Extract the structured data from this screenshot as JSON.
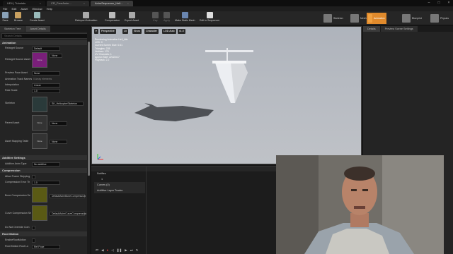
{
  "titlebar": {
    "tabs": [
      {
        "label": "UE4 | Tutorials",
        "active": false
      },
      {
        "label": "CR_FreeAnim...",
        "active": false
      },
      {
        "label": "AnimSequence_Heli...",
        "active": true
      }
    ]
  },
  "menu": [
    "File",
    "Edit",
    "Asset",
    "Window",
    "Help"
  ],
  "toolbar": {
    "buttons": [
      "Save",
      "Browse",
      "Create Asset",
      "Reimport Animation",
      "Compression",
      "Export Asset",
      "Key",
      "Apply",
      "Make Static Mesh",
      "Edit in Sequencer"
    ]
  },
  "modes": [
    "Skeleton",
    "Mesh",
    "Animation",
    "Blueprint",
    "Physics"
  ],
  "left_panel": {
    "tabs": [
      "Skeleton Tree",
      "Asset Details"
    ],
    "search_placeholder": "Search Details",
    "sections": {
      "animation": "Animation",
      "additive": "Additive Settings",
      "compression": "Compression",
      "root_motion": "Root Motion"
    },
    "rows": {
      "retarget_source": {
        "name": "Retarget Source",
        "value": "Default"
      },
      "retarget_source_asset": {
        "name": "Retarget Source Asset",
        "value": "None"
      },
      "preview_pose_asset": {
        "name": "Preview Pose Asset",
        "value": "None"
      },
      "animation_track_names": {
        "name": "Animation Track Names",
        "value": "0 Array elements"
      },
      "interpolation": {
        "name": "Interpolation",
        "value": "Linear"
      },
      "rate_scale": {
        "name": "Rate Scale",
        "value": "1.0"
      },
      "skeleton": {
        "name": "Skeleton",
        "value": "SK_HelicopterSkeleton"
      },
      "parent_asset": {
        "name": "Parent Asset",
        "value": "None"
      },
      "asset_mapping_table": {
        "name": "Asset Mapping Table",
        "value": "None"
      },
      "additive_anim_type": {
        "name": "Additive Anim Type",
        "value": "No additive"
      },
      "allow_frame_stripping": {
        "name": "Allow Frame Stripping",
        "value": ""
      },
      "compression_error_threshold": {
        "name": "Compression Error Th",
        "value": "1.0"
      },
      "bone_compression": {
        "name": "Bone Compression Se",
        "value": "DefaultAnimBoneCompression"
      },
      "curve_compression": {
        "name": "Curve Compression Se",
        "value": "DefaultAnimCurveCompression"
      },
      "do_not_override_compression": {
        "name": "Do Not Override Com",
        "value": ""
      },
      "enable_root_motion": {
        "name": "EnableRootMotion",
        "value": ""
      },
      "root_motion_root_lock": {
        "name": "Root Motion Root Lo",
        "value": "Ref Pose"
      }
    }
  },
  "viewport": {
    "buttons": [
      "Perspective",
      "Lit",
      "Show",
      "Character",
      "LOD Auto",
      "x1.0"
    ],
    "info": "Previewing Animation Heli_Idle\nLOD: 0\nCurrent Screen Size: 0.61\nTriangles: 228\nVertices: 176\nUV Channels: 1\nApprox Size: 22x22x17\nPlayback: 2.2"
  },
  "details": {
    "tabs": [
      "Details",
      "Preview Scene Settings"
    ]
  },
  "timeline": {
    "rows": [
      "Notifies",
      "1",
      "Curves (0)",
      "Additive Layer Tracks"
    ]
  }
}
